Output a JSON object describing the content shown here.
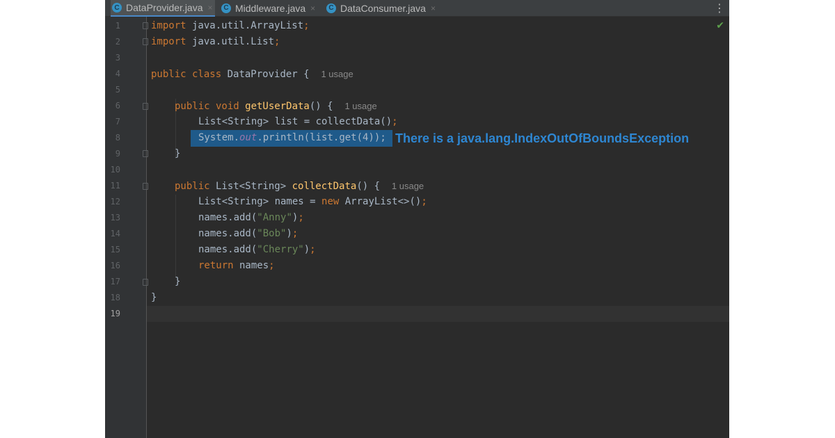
{
  "tabs": [
    {
      "label": "DataProvider.java",
      "icon": "class-icon",
      "active": true
    },
    {
      "label": "Middleware.java",
      "icon": "class-icon",
      "active": false
    },
    {
      "label": "DataConsumer.java",
      "icon": "class-icon",
      "active": false
    }
  ],
  "icons": {
    "class_letter": "C",
    "close": "×",
    "menu": "⋮",
    "check": "✔"
  },
  "line_numbers": [
    "1",
    "2",
    "3",
    "4",
    "5",
    "6",
    "7",
    "8",
    "9",
    "10",
    "11",
    "12",
    "13",
    "14",
    "15",
    "16",
    "17",
    "18",
    "19"
  ],
  "code": {
    "l1_kw": "import",
    "l1_rest": " java.util.ArrayList",
    "l1_semi": ";",
    "l2_kw": "import",
    "l2_rest": " java.util.List",
    "l2_semi": ";",
    "l4_kw": "public class",
    "l4_rest": " DataProvider {",
    "l4_hint": "1 usage",
    "l6_kw": "public void",
    "l6_fn": " getUserData",
    "l6_rest": "() {",
    "l6_hint": "1 usage",
    "l7_rest": "List<String> list = collectData()",
    "l7_semi": ";",
    "l8_a": "System.",
    "l8_out": "out",
    "l8_b": ".println(list.get(4));",
    "l9": "}",
    "l11_kw": "public",
    "l11_mid": " List<String>",
    "l11_fn": " collectData",
    "l11_rest": "() {",
    "l11_hint": "1 usage",
    "l12_a": "List<String> names = ",
    "l12_kw": "new",
    "l12_b": " ArrayList<>()",
    "l12_semi": ";",
    "l13_a": "names.add(",
    "l13_s": "\"Anny\"",
    "l13_b": ")",
    "l13_semi": ";",
    "l14_a": "names.add(",
    "l14_s": "\"Bob\"",
    "l14_b": ")",
    "l14_semi": ";",
    "l15_a": "names.add(",
    "l15_s": "\"Cherry\"",
    "l15_b": ")",
    "l15_semi": ";",
    "l16_kw": "return",
    "l16_rest": " names",
    "l16_semi": ";",
    "l17": "}",
    "l18": "}"
  },
  "annotation": "There is a java.lang.IndexOutOfBoundsException",
  "colors": {
    "selection": "#1f5a8a",
    "annotation": "#2e86d1",
    "keyword": "#cc7832",
    "function": "#ffc66d",
    "string": "#6a8759"
  }
}
